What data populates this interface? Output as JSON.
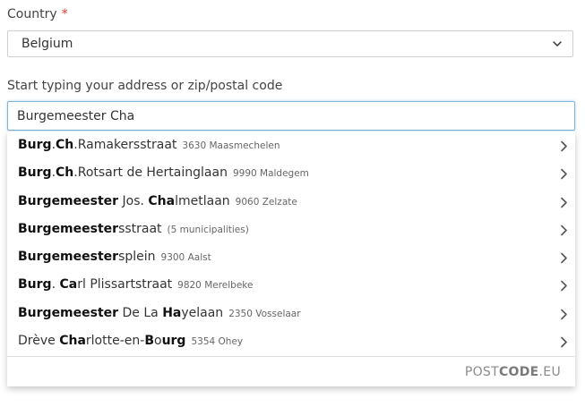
{
  "country_field": {
    "label": "Country",
    "required_marker": "*",
    "selected_value": "Belgium"
  },
  "address_field": {
    "label": "Start typing your address or zip/postal code",
    "value": "Burgemeester Cha"
  },
  "suggestions": [
    {
      "parts": [
        {
          "t": "Burg",
          "b": true
        },
        {
          "t": ".",
          "b": false
        },
        {
          "t": "Ch",
          "b": true
        },
        {
          "t": ".Ramakersstraat",
          "b": false
        }
      ],
      "locality": "3630 Maasmechelen"
    },
    {
      "parts": [
        {
          "t": "Burg",
          "b": true
        },
        {
          "t": ".",
          "b": false
        },
        {
          "t": "Ch",
          "b": true
        },
        {
          "t": ".Rotsart de Hertainglaan",
          "b": false
        }
      ],
      "locality": "9990 Maldegem"
    },
    {
      "parts": [
        {
          "t": "Burgemeester",
          "b": true
        },
        {
          "t": " Jos. ",
          "b": false
        },
        {
          "t": "Cha",
          "b": true
        },
        {
          "t": "lmetlaan",
          "b": false
        }
      ],
      "locality": "9060 Zelzate"
    },
    {
      "parts": [
        {
          "t": "Burgemeester",
          "b": true
        },
        {
          "t": "sstraat",
          "b": false
        }
      ],
      "locality": "(5 municipalities)"
    },
    {
      "parts": [
        {
          "t": "Burgemeester",
          "b": true
        },
        {
          "t": "splein",
          "b": false
        }
      ],
      "locality": "9300 Aalst"
    },
    {
      "parts": [
        {
          "t": "Burg",
          "b": true
        },
        {
          "t": ". ",
          "b": false
        },
        {
          "t": "Ca",
          "b": true
        },
        {
          "t": "rl Plissartstraat",
          "b": false
        }
      ],
      "locality": "9820 Merelbeke"
    },
    {
      "parts": [
        {
          "t": "Burgemeester",
          "b": true
        },
        {
          "t": " De La ",
          "b": false
        },
        {
          "t": "Ha",
          "b": true
        },
        {
          "t": "yelaan",
          "b": false
        }
      ],
      "locality": "2350 Vosselaar"
    },
    {
      "parts": [
        {
          "t": "Drève ",
          "b": false
        },
        {
          "t": "Cha",
          "b": true
        },
        {
          "t": "rlotte-en-",
          "b": false
        },
        {
          "t": "B",
          "b": true
        },
        {
          "t": "o",
          "b": false
        },
        {
          "t": "urg",
          "b": true
        }
      ],
      "locality": "5354 Ohey"
    }
  ],
  "brand": {
    "prefix": "POST",
    "highlight": "CODE",
    "suffix": ".EU"
  },
  "icons": {
    "select_chevron": "chevron-down-icon",
    "suggestion_chevron": "chevron-right-icon"
  },
  "colors": {
    "required": "#e53935",
    "input_focus_border": "#7fb5d6"
  }
}
